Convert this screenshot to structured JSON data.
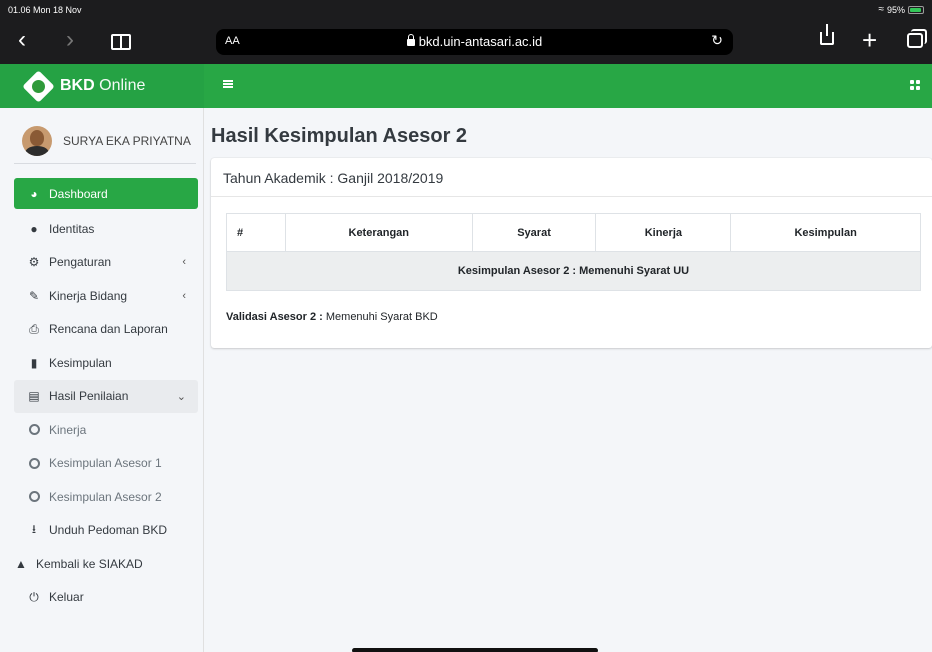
{
  "status_bar": {
    "time": "01.06  Mon 18 Nov",
    "battery": "95%"
  },
  "browser": {
    "aa": "AA",
    "url": "bkd.uin-antasari.ac.id"
  },
  "brand": {
    "bold": "BKD",
    "rest": " Online"
  },
  "user": {
    "name": "SURYA EKA PRIYATNA"
  },
  "menu": [
    {
      "label": "Dashboard",
      "icon": "dashboard-icon"
    },
    {
      "label": "Identitas",
      "icon": "user-icon"
    },
    {
      "label": "Pengaturan",
      "icon": "gear-icon"
    },
    {
      "label": "Kinerja Bidang",
      "icon": "edit-icon"
    },
    {
      "label": "Rencana dan Laporan",
      "icon": "print-icon"
    },
    {
      "label": "Kesimpulan",
      "icon": "book-icon"
    },
    {
      "label": "Hasil Penilaian",
      "icon": "file-icon"
    },
    {
      "label": "Kinerja",
      "icon": "circle-icon"
    },
    {
      "label": "Kesimpulan Asesor 1",
      "icon": "circle-icon"
    },
    {
      "label": "Kesimpulan Asesor 2",
      "icon": "circle-icon"
    },
    {
      "label": "Unduh Pedoman BKD",
      "icon": "download-icon"
    },
    {
      "label": "Kembali ke SIAKAD",
      "icon": "graduation-cap-icon"
    },
    {
      "label": "Keluar",
      "icon": "power-icon"
    }
  ],
  "page": {
    "title": "Hasil Kesimpulan Asesor 2",
    "card_header": "Tahun Akademik : Ganjil 2018/2019",
    "table": {
      "columns": [
        "#",
        "Keterangan",
        "Syarat",
        "Kinerja",
        "Kesimpulan"
      ],
      "summary": "Kesimpulan Asesor 2 : Memenuhi Syarat UU"
    },
    "validasi_label": "Validasi Asesor 2 :",
    "validasi_value": " Memenuhi Syarat BKD"
  }
}
